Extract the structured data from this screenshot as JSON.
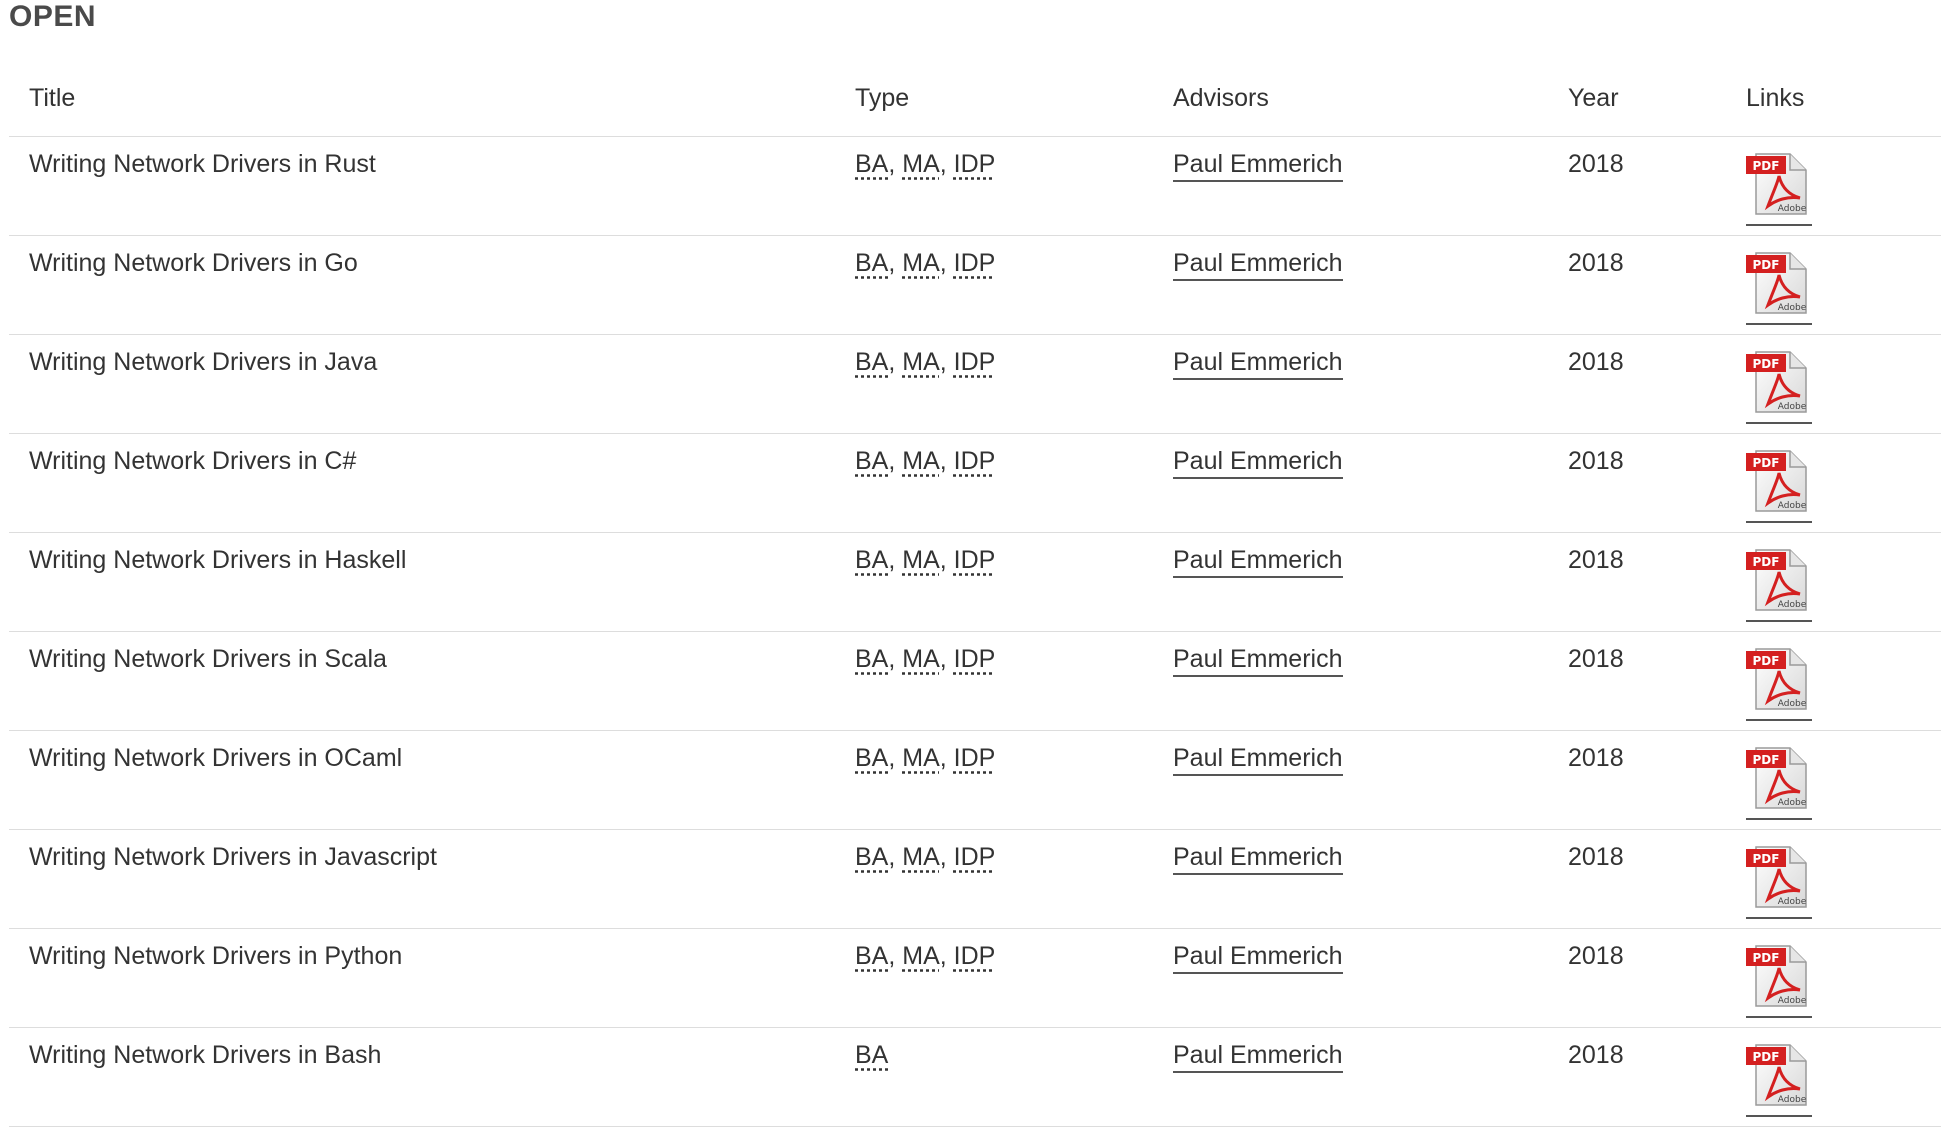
{
  "section": {
    "heading": "OPEN"
  },
  "table": {
    "headers": {
      "title": "Title",
      "type": "Type",
      "advisors": "Advisors",
      "year": "Year",
      "links": "Links"
    },
    "rows": [
      {
        "title": "Writing Network Drivers in Rust",
        "types": [
          "BA",
          "MA",
          "IDP"
        ],
        "advisor": "Paul Emmerich",
        "year": "2018",
        "link_icon": "pdf-icon"
      },
      {
        "title": "Writing Network Drivers in Go",
        "types": [
          "BA",
          "MA",
          "IDP"
        ],
        "advisor": "Paul Emmerich",
        "year": "2018",
        "link_icon": "pdf-icon"
      },
      {
        "title": "Writing Network Drivers in Java",
        "types": [
          "BA",
          "MA",
          "IDP"
        ],
        "advisor": "Paul Emmerich",
        "year": "2018",
        "link_icon": "pdf-icon"
      },
      {
        "title": "Writing Network Drivers in C#",
        "types": [
          "BA",
          "MA",
          "IDP"
        ],
        "advisor": "Paul Emmerich",
        "year": "2018",
        "link_icon": "pdf-icon"
      },
      {
        "title": "Writing Network Drivers in Haskell",
        "types": [
          "BA",
          "MA",
          "IDP"
        ],
        "advisor": "Paul Emmerich",
        "year": "2018",
        "link_icon": "pdf-icon"
      },
      {
        "title": "Writing Network Drivers in Scala",
        "types": [
          "BA",
          "MA",
          "IDP"
        ],
        "advisor": "Paul Emmerich",
        "year": "2018",
        "link_icon": "pdf-icon"
      },
      {
        "title": "Writing Network Drivers in OCaml",
        "types": [
          "BA",
          "MA",
          "IDP"
        ],
        "advisor": "Paul Emmerich",
        "year": "2018",
        "link_icon": "pdf-icon"
      },
      {
        "title": "Writing Network Drivers in Javascript",
        "types": [
          "BA",
          "MA",
          "IDP"
        ],
        "advisor": "Paul Emmerich",
        "year": "2018",
        "link_icon": "pdf-icon"
      },
      {
        "title": "Writing Network Drivers in Python",
        "types": [
          "BA",
          "MA",
          "IDP"
        ],
        "advisor": "Paul Emmerich",
        "year": "2018",
        "link_icon": "pdf-icon"
      },
      {
        "title": "Writing Network Drivers in Bash",
        "types": [
          "BA"
        ],
        "advisor": "Paul Emmerich",
        "year": "2018",
        "link_icon": "pdf-icon"
      }
    ]
  },
  "pdf_icon": {
    "label": "PDF",
    "sublabel": "Adobe",
    "red": "#d42020"
  },
  "colors": {
    "text": "#333333",
    "heading": "#4a4a4a",
    "row_border": "#dddddd"
  }
}
